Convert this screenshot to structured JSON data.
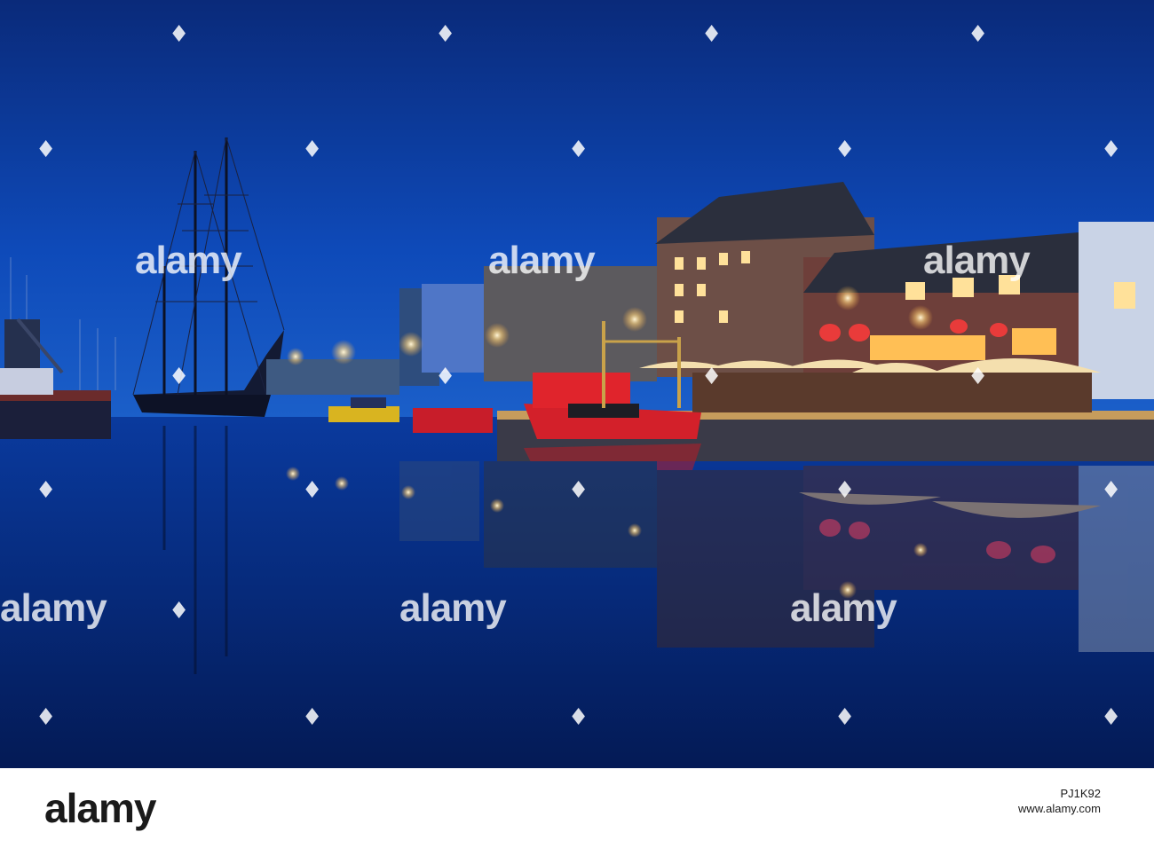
{
  "scene": {
    "description_colors": {
      "sky_top": "#0b2f86",
      "sky_mid": "#0d47b8",
      "water": "#06205f",
      "warm_light": "#ffc766",
      "boat_red": "#d3202a"
    }
  },
  "watermark": {
    "word": "alamy",
    "diamond_glyph": "♦"
  },
  "footer": {
    "logo": "alamy",
    "url": "www.alamy.com",
    "image_id": "PJ1K92"
  }
}
